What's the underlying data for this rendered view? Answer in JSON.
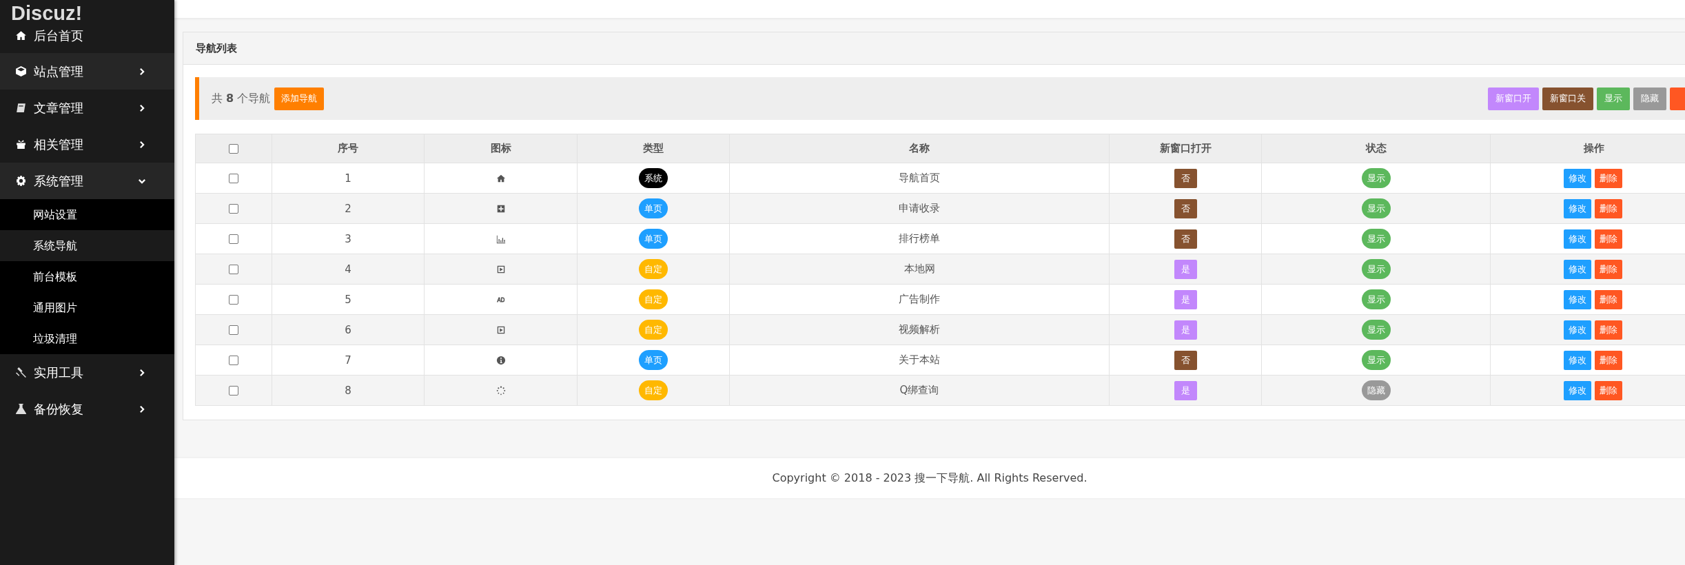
{
  "sidebar": {
    "logo": "Discuz!",
    "items": [
      {
        "label": "后台首页",
        "has_children": false
      },
      {
        "label": "站点管理",
        "has_children": true,
        "expanded": false
      },
      {
        "label": "文章管理",
        "has_children": true,
        "expanded": false
      },
      {
        "label": "相关管理",
        "has_children": true,
        "expanded": false
      },
      {
        "label": "系统管理",
        "has_children": true,
        "expanded": true,
        "children": [
          {
            "label": "网站设置",
            "selected": false
          },
          {
            "label": "系统导航",
            "selected": true
          },
          {
            "label": "前台模板",
            "selected": false
          },
          {
            "label": "通用图片",
            "selected": false
          },
          {
            "label": "垃圾清理",
            "selected": false
          }
        ]
      },
      {
        "label": "实用工具",
        "has_children": true,
        "expanded": false
      },
      {
        "label": "备份恢复",
        "has_children": true,
        "expanded": false
      }
    ]
  },
  "panel": {
    "title": "导航列表",
    "toolbar": {
      "count_prefix": "共",
      "count": "8",
      "count_suffix": "个导航",
      "add_button": "添加导航",
      "buttons": [
        {
          "label": "新窗口开",
          "color": "#c287fc"
        },
        {
          "label": "新窗口关",
          "color": "#86522f"
        },
        {
          "label": "显示",
          "color": "#5cb85c"
        },
        {
          "label": "隐藏",
          "color": "#999999"
        },
        {
          "color": "#ff5722"
        }
      ]
    },
    "table": {
      "select_all_checked": false,
      "columns": [
        "序号",
        "图标",
        "类型",
        "名称",
        "新窗口打开",
        "状态",
        "操作"
      ],
      "rows": [
        {
          "checked": false,
          "index": "1",
          "type": {
            "label": "系统",
            "kind": "system"
          },
          "name": "导航首页",
          "new_window": {
            "label": "否",
            "on": false
          },
          "status": {
            "label": "显示",
            "visible": true
          },
          "edit": "修改",
          "delete": "删除"
        },
        {
          "checked": false,
          "index": "2",
          "type": {
            "label": "单页",
            "kind": "page"
          },
          "name": "申请收录",
          "new_window": {
            "label": "否",
            "on": false
          },
          "status": {
            "label": "显示",
            "visible": true
          },
          "edit": "修改",
          "delete": "删除"
        },
        {
          "checked": false,
          "index": "3",
          "type": {
            "label": "单页",
            "kind": "page"
          },
          "name": "排行榜单",
          "new_window": {
            "label": "否",
            "on": false
          },
          "status": {
            "label": "显示",
            "visible": true
          },
          "edit": "修改",
          "delete": "删除"
        },
        {
          "checked": false,
          "index": "4",
          "type": {
            "label": "自定",
            "kind": "custom"
          },
          "name": "本地网",
          "new_window": {
            "label": "是",
            "on": true
          },
          "status": {
            "label": "显示",
            "visible": true
          },
          "edit": "修改",
          "delete": "删除"
        },
        {
          "checked": false,
          "index": "5",
          "type": {
            "label": "自定",
            "kind": "custom"
          },
          "name": "广告制作",
          "new_window": {
            "label": "是",
            "on": true
          },
          "status": {
            "label": "显示",
            "visible": true
          },
          "edit": "修改",
          "delete": "删除"
        },
        {
          "checked": false,
          "index": "6",
          "type": {
            "label": "自定",
            "kind": "custom"
          },
          "name": "视频解析",
          "new_window": {
            "label": "是",
            "on": true
          },
          "status": {
            "label": "显示",
            "visible": true
          },
          "edit": "修改",
          "delete": "删除"
        },
        {
          "checked": false,
          "index": "7",
          "type": {
            "label": "单页",
            "kind": "page"
          },
          "name": "关于本站",
          "new_window": {
            "label": "否",
            "on": false
          },
          "status": {
            "label": "显示",
            "visible": true
          },
          "edit": "修改",
          "delete": "删除"
        },
        {
          "checked": false,
          "index": "8",
          "type": {
            "label": "自定",
            "kind": "custom"
          },
          "name": "Q绑查询",
          "new_window": {
            "label": "是",
            "on": true
          },
          "status": {
            "label": "隐藏",
            "visible": false
          },
          "edit": "修改",
          "delete": "删除"
        }
      ]
    }
  },
  "footer": "Copyright © 2018 - 2023 搜一下导航. All Rights Reserved."
}
